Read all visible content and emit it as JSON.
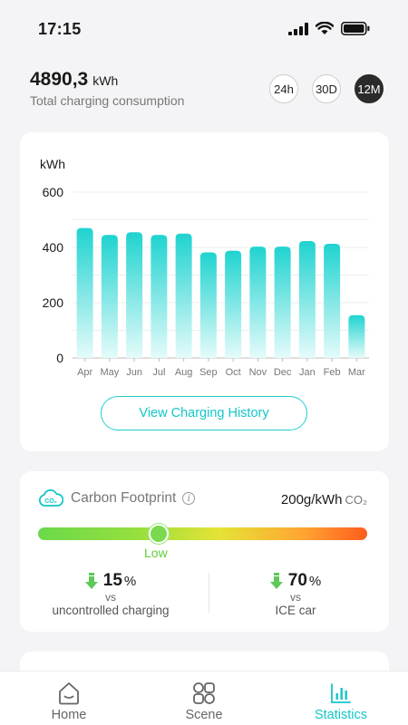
{
  "status_bar": {
    "time": "17:15",
    "icons": [
      "signal-icon",
      "wifi-icon",
      "battery-icon"
    ]
  },
  "summary": {
    "value": "4890,3",
    "unit": "kWh",
    "caption": "Total charging consumption",
    "ranges": [
      {
        "label": "24h",
        "active": false
      },
      {
        "label": "30D",
        "active": false
      },
      {
        "label": "12M",
        "active": true
      }
    ]
  },
  "chart_data": {
    "type": "bar",
    "ylabel": "kWh",
    "categories": [
      "Apr",
      "May",
      "Jun",
      "Jul",
      "Aug",
      "Sep",
      "Oct",
      "Nov",
      "Dec",
      "Jan",
      "Feb",
      "Mar"
    ],
    "values": [
      470,
      445,
      455,
      445,
      450,
      382,
      388,
      403,
      403,
      423,
      413,
      155
    ],
    "ylim": [
      0,
      600
    ],
    "yticks": [
      "0",
      "200",
      "400",
      "600"
    ],
    "grid": true,
    "colors": {
      "bar_top": "#1fd3d0",
      "bar_bottom": "#e4fbfa"
    }
  },
  "history_button": {
    "label": "View Charging History"
  },
  "carbon": {
    "title": "Carbon Footprint",
    "rate_value": "200g/kWh",
    "rate_unit": "CO₂",
    "level": "Low",
    "level_fraction": 0.37,
    "stats": [
      {
        "value": "15",
        "unit": "%",
        "vs": "vs",
        "desc": "uncontrolled charging"
      },
      {
        "value": "70",
        "unit": "%",
        "vs": "vs",
        "desc": "ICE car"
      }
    ]
  },
  "tabs": [
    {
      "label": "Home",
      "icon": "home-icon",
      "active": false
    },
    {
      "label": "Scene",
      "icon": "scene-icon",
      "active": false
    },
    {
      "label": "Statistics",
      "icon": "statistics-icon",
      "active": true
    }
  ],
  "accent_color": "#13c6c8"
}
